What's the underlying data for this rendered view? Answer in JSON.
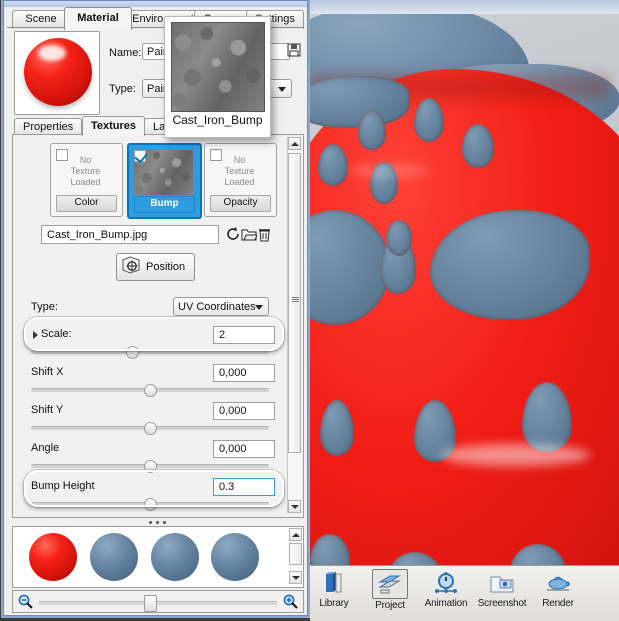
{
  "window": {
    "top_tabs": [
      {
        "label": "Scene",
        "active": false
      },
      {
        "label": "Material",
        "active": true
      },
      {
        "label": "Environment",
        "active": false
      },
      {
        "label": "Camera",
        "active": false
      },
      {
        "label": "Settings",
        "active": false
      }
    ],
    "sub_tabs": [
      {
        "label": "Properties",
        "active": false
      },
      {
        "label": "Textures",
        "active": true
      },
      {
        "label": "Labels",
        "active": false
      }
    ]
  },
  "material": {
    "name_label": "Name:",
    "name_value": "Paint",
    "type_label": "Type:",
    "type_value": "Paint",
    "save_icon": "save-floppy-icon"
  },
  "tooltip": {
    "caption": "Cast_Iron_Bump",
    "thumb_icon": "texture-thumbnail"
  },
  "texture_slots": [
    {
      "caption": "Color",
      "empty_text": "No\nTexture\nLoaded",
      "checked": false,
      "selected": false
    },
    {
      "caption": "Bump",
      "empty_text": "",
      "checked": true,
      "selected": true
    },
    {
      "caption": "Opacity",
      "empty_text": "No\nTexture\nLoaded",
      "checked": false,
      "selected": false
    }
  ],
  "file": {
    "name": "Cast_Iron_Bump.jpg",
    "icons": [
      "refresh-icon",
      "open-folder-icon",
      "trash-icon"
    ]
  },
  "position_button": {
    "label": "Position",
    "icon": "cube-position-icon"
  },
  "mapping": {
    "type_label": "Type:",
    "type_value": "UV Coordinates",
    "type_options": [
      "UV Coordinates"
    ]
  },
  "parameters": [
    {
      "label": "Scale:",
      "value": "2",
      "slider_pct": 43,
      "expandable": true,
      "highlighted": true,
      "focused": false
    },
    {
      "label": "Shift X",
      "value": "0,000",
      "slider_pct": 50,
      "expandable": false,
      "highlighted": false,
      "focused": false
    },
    {
      "label": "Shift Y",
      "value": "0,000",
      "slider_pct": 50,
      "expandable": false,
      "highlighted": false,
      "focused": false
    },
    {
      "label": "Angle",
      "value": "0,000",
      "slider_pct": 50,
      "expandable": false,
      "highlighted": false,
      "focused": false
    },
    {
      "label": "Bump Height",
      "value": "0.3",
      "slider_pct": 50,
      "expandable": false,
      "highlighted": true,
      "focused": true
    }
  ],
  "library": {
    "spheres": [
      "red",
      "blue",
      "blue",
      "blue"
    ]
  },
  "zoom_slider": {
    "zoom_out_icon": "zoom-out-magnifier-icon",
    "zoom_in_icon": "zoom-in-magnifier-icon",
    "value_pct": 45
  },
  "toolbar": {
    "buttons": [
      {
        "label": "Library",
        "icon": "library-book-icon",
        "selected": false
      },
      {
        "label": "Project",
        "icon": "project-stack-icon",
        "selected": true
      },
      {
        "label": "Animation",
        "icon": "animation-clock-icon",
        "selected": false
      },
      {
        "label": "Screenshot",
        "icon": "screenshot-folder-icon",
        "selected": false
      },
      {
        "label": "Render",
        "icon": "render-teapot-icon",
        "selected": false
      }
    ]
  },
  "viewport": {
    "name": "3d-render-viewport",
    "colors": {
      "body": "#f52318",
      "spots": "#678architecture"
    }
  },
  "colors": {
    "accent": "#2f9ce0",
    "red": "#f52318",
    "blue": "#678ba6",
    "panel_bg": "#f0f0f0"
  }
}
